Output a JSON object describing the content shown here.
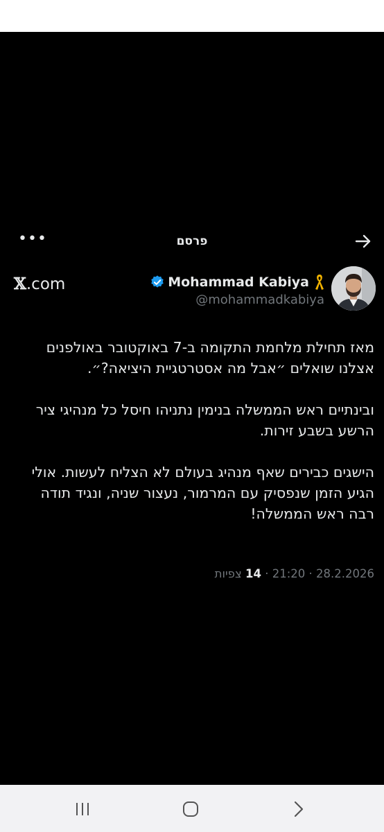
{
  "header": {
    "title": "פרסם",
    "back_icon": "arrow-right-icon",
    "more_icon": "more-horizontal-icon",
    "more_label": "•••"
  },
  "brand": {
    "x": "𝕏",
    "suffix": ".com"
  },
  "author": {
    "display_name": "Mohammad Kabiya",
    "handle": "@mohammadkabiya",
    "verified_color": "#1d9bf0",
    "ribbon_color": "#f4b400"
  },
  "tweet": {
    "paragraphs": [
      "מאז תחילת מלחמת התקומה ב-7 באוקטובר באולפנים אצלנו שואלים ״אבל מה אסטרטגיית היציאה?״.",
      "ובינתיים ראש הממשלה בנימין נתניהו חיסל כל מנהיגי ציר הרשע בשבע זירות.",
      "הישגים כבירים שאף מנהיג בעולם לא הצליח לעשות. אולי הגיע הזמן שנפסיק עם המרמור, נעצור שניה, ונגיד תודה רבה ראש הממשלה!"
    ]
  },
  "meta": {
    "date": "28.2.2026",
    "time": "21:20",
    "sep": "·",
    "views_count": "14",
    "views_label": "צפיות"
  },
  "navbar": {
    "recents_icon": "recent-apps-icon",
    "home_icon": "home-icon",
    "back_icon": "back-icon"
  }
}
